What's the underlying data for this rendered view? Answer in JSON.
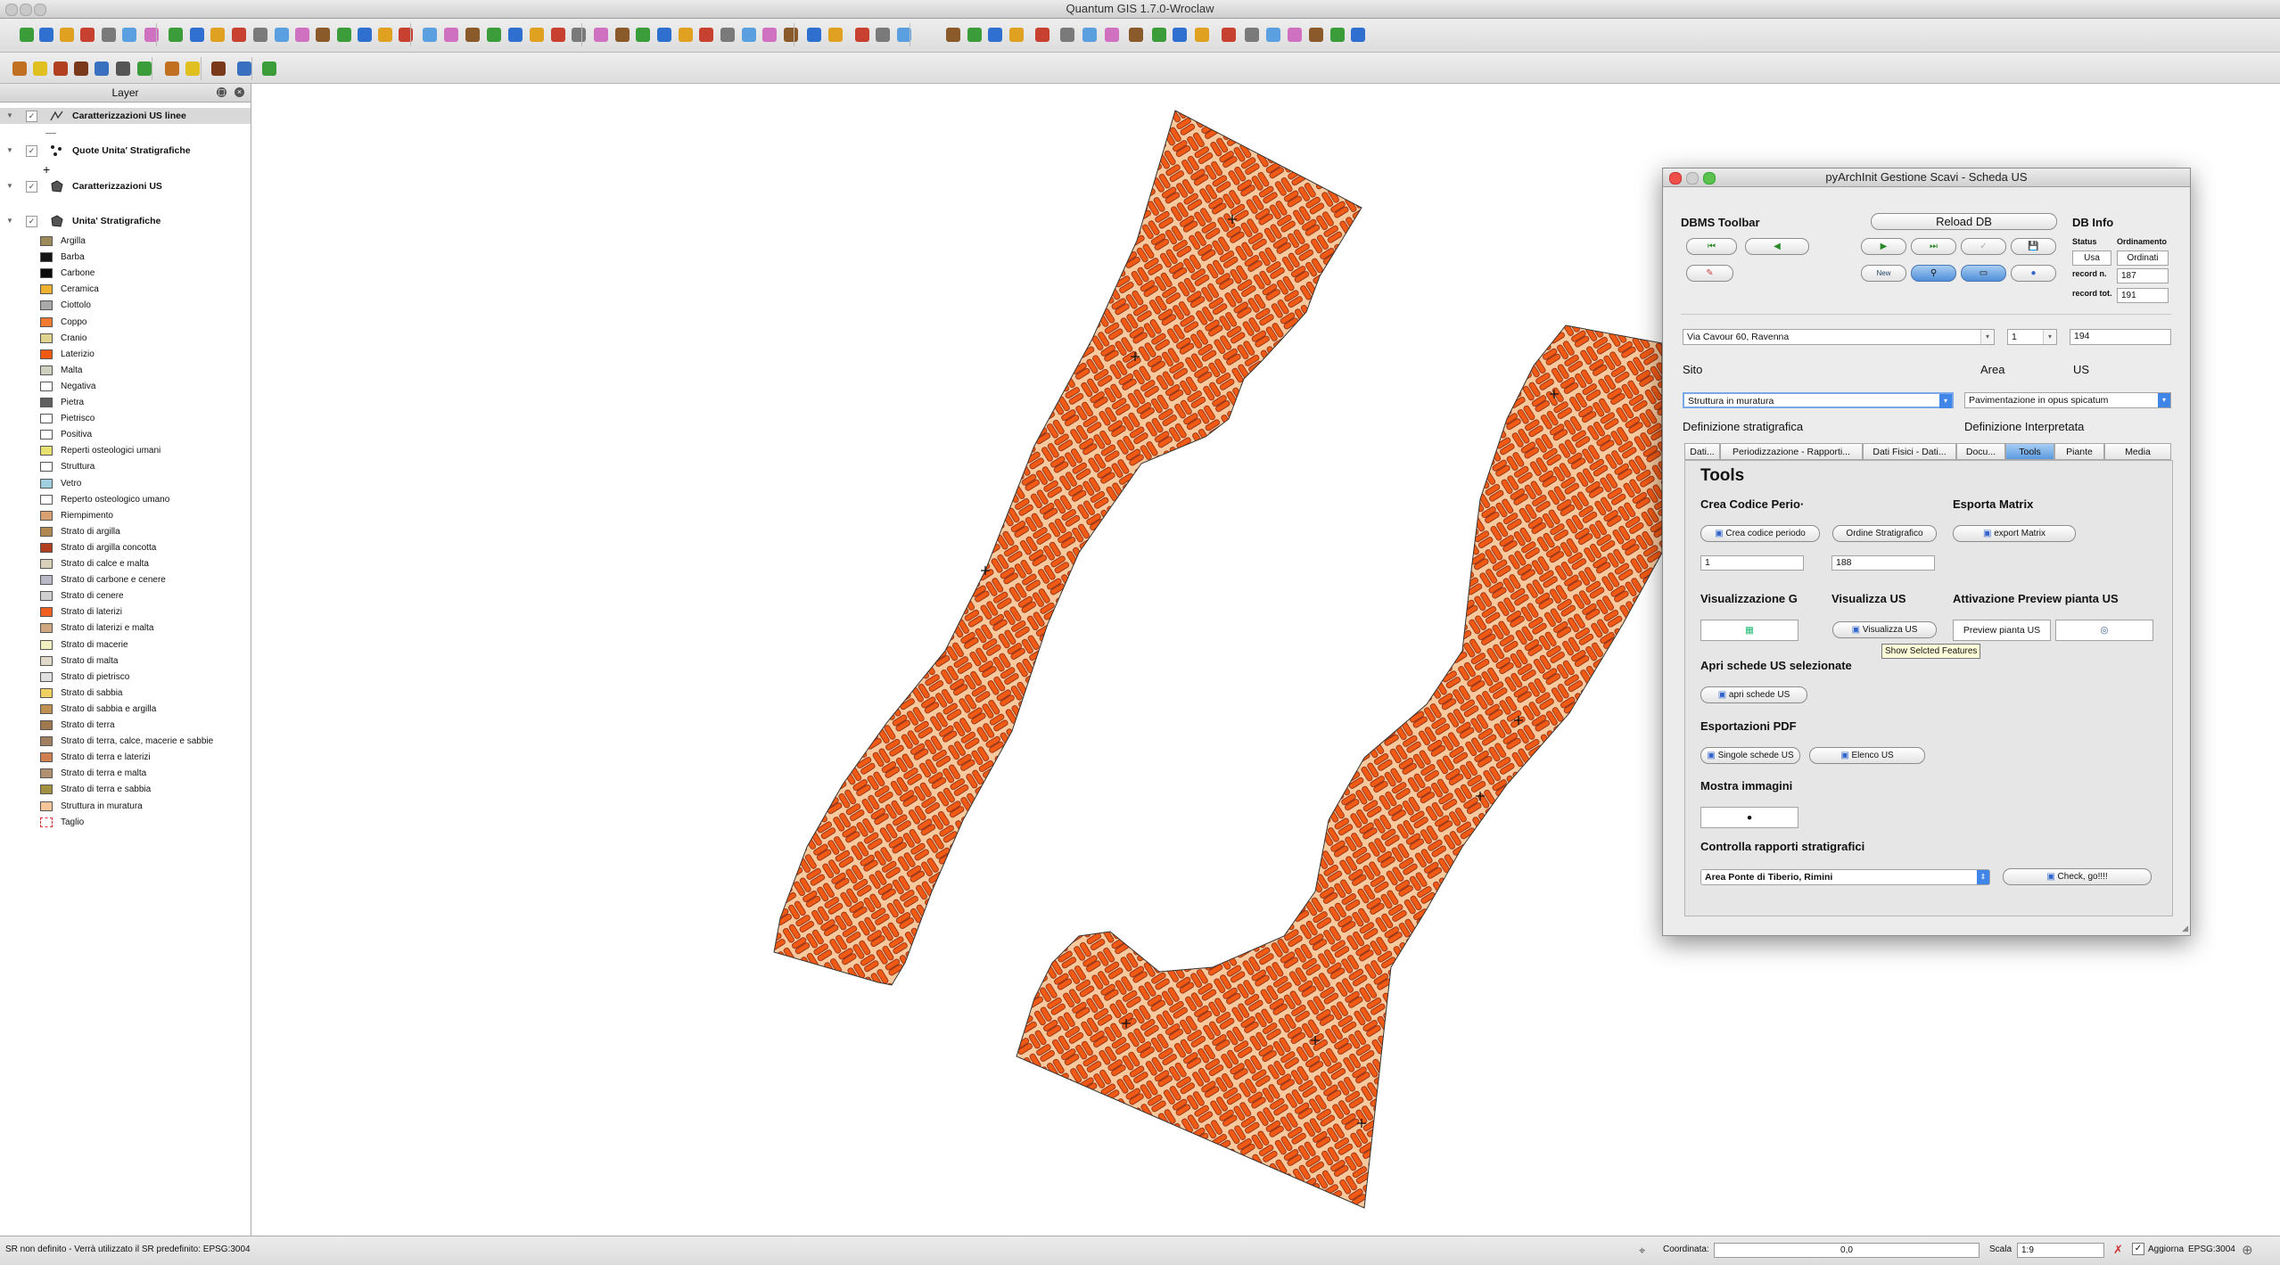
{
  "window": {
    "title": "Quantum GIS 1.7.0-Wroclaw"
  },
  "layers_panel": {
    "title": "Layer",
    "layers": [
      {
        "name": "Caratterizzazioni US linee",
        "checked": true
      },
      {
        "name": "Quote Unita' Stratigrafiche",
        "checked": true
      },
      {
        "name": "Caratterizzazioni US",
        "checked": true
      },
      {
        "name": "Unita' Stratigrafiche",
        "checked": true
      }
    ],
    "legend": [
      {
        "label": "Argilla",
        "color": "#9c8a5a"
      },
      {
        "label": "Barba",
        "color": "#141414"
      },
      {
        "label": "Carbone",
        "color": "#0a0a0a"
      },
      {
        "label": "Ceramica",
        "color": "#f0b030"
      },
      {
        "label": "Ciottolo",
        "color": "#a9a9a9"
      },
      {
        "label": "Coppo",
        "color": "#f07a30"
      },
      {
        "label": "Cranio",
        "color": "#e0d490"
      },
      {
        "label": "Laterizio",
        "color": "#f05a10"
      },
      {
        "label": "Malta",
        "color": "#d0d0c0"
      },
      {
        "label": "Negativa",
        "color": "#ffffff"
      },
      {
        "label": "Pietra",
        "color": "#606060"
      },
      {
        "label": "Pietrisco",
        "color": "#ffffff"
      },
      {
        "label": "Positiva",
        "color": "#ffffff"
      },
      {
        "label": "Reperti osteologici umani",
        "color": "#e8e070"
      },
      {
        "label": "Struttura",
        "color": "#ffffff"
      },
      {
        "label": "Vetro",
        "color": "#a0d0e0"
      },
      {
        "label": "Reperto osteologico umano",
        "color": "#ffffff"
      },
      {
        "label": "Riempimento",
        "color": "#d8a070"
      },
      {
        "label": "Strato di argilla",
        "color": "#b08850"
      },
      {
        "label": "Strato di argilla concotta",
        "color": "#b04020"
      },
      {
        "label": "Strato di calce e malta",
        "color": "#d8d0b8"
      },
      {
        "label": "Strato di carbone e cenere",
        "color": "#b8b8c8"
      },
      {
        "label": "Strato di cenere",
        "color": "#d0d0d0"
      },
      {
        "label": "Strato di laterizi",
        "color": "#f06020"
      },
      {
        "label": "Strato di laterizi e malta",
        "color": "#d0a880"
      },
      {
        "label": "Strato di macerie",
        "color": "#f0f0c0"
      },
      {
        "label": "Strato di malta",
        "color": "#e0d8c8"
      },
      {
        "label": "Strato di pietrisco",
        "color": "#e0e0e0"
      },
      {
        "label": "Strato di sabbia",
        "color": "#f0d060"
      },
      {
        "label": "Strato di sabbia e argilla",
        "color": "#c09050"
      },
      {
        "label": "Strato di terra",
        "color": "#a07850"
      },
      {
        "label": "Strato di terra, calce, macerie e sabbie",
        "color": "#a08060"
      },
      {
        "label": "Strato di terra e laterizi",
        "color": "#d08050"
      },
      {
        "label": "Strato di terra e malta",
        "color": "#b09070"
      },
      {
        "label": "Strato di terra e sabbia",
        "color": "#a09040"
      },
      {
        "label": "Struttura in muratura",
        "color": "#f7c79a"
      },
      {
        "label": "Taglio",
        "color": "#ffffff"
      }
    ]
  },
  "colors": {
    "brick": "#f05a14",
    "brick_edge": "#7a1a08",
    "mortar": "#f8c99c",
    "accent_blue": "#3f86e8"
  },
  "statusbar": {
    "message": "SR non definito - Verrà utilizzato il SR predefinito: EPSG:3004",
    "coord_label": "Coordinata:",
    "coord_value": "0,0",
    "scale_label": "Scala",
    "scale_value": "1:9",
    "render_label": "Aggiorna",
    "epsg": "EPSG:3004"
  },
  "dialog": {
    "title": "pyArchInit Gestione Scavi - Scheda US",
    "dbms_toolbar": "DBMS Toolbar",
    "reload_db": "Reload DB",
    "new_label": "New",
    "db_info": "DB Info",
    "status_label": "Status",
    "status_value": "Usa",
    "ordering_label": "Ordinamento",
    "ordering_value": "Ordinati",
    "record_n_label": "record n.",
    "record_n_value": "187",
    "record_tot_label": "record tot.",
    "record_tot_value": "191",
    "sito_value": "Via Cavour 60, Ravenna",
    "area_value": "1",
    "us_value": "194",
    "sito_label": "Sito",
    "area_label": "Area",
    "us_label": "US",
    "def_strat_value": "Struttura in muratura",
    "def_interp_value": "Pavimentazione in opus spicatum",
    "def_strat_label": "Definizione stratigrafica",
    "def_interp_label": "Definizione Interpretata",
    "tabs": [
      "Dati...",
      "Periodizzazione - Rapporti...",
      "Dati Fisici - Dati...",
      "Docu...",
      "Tools",
      "Piante",
      "Media"
    ],
    "active_tab": "Tools",
    "tools": {
      "heading": "Tools",
      "crea_codice_label": "Crea Codice Perio·",
      "esporta_matrix_label": "Esporta Matrix",
      "crea_codice_btn": "Crea codice periodo",
      "ordine_btn": "Ordine Stratigrafico",
      "export_matrix_btn": "export Matrix",
      "field1": "1",
      "field2": "188",
      "vis_g_label": "Visualizzazione G",
      "vis_us_label": "Visualizza US",
      "preview_label": "Attivazione Preview pianta US",
      "vis_us_btn": "Visualizza US",
      "preview_btn": "Preview pianta US",
      "tooltip": "Show Selcted Features",
      "apri_label": "Apri schede US selezionate",
      "apri_btn": "apri schede US",
      "pdf_label": "Esportazioni PDF",
      "singole_btn": "Singole schede US",
      "elenco_btn": "Elenco US",
      "immagini_label": "Mostra immagini",
      "controlla_label": "Controlla rapporti stratigrafici",
      "controlla_combo": "Area Ponte di Tiberio, Rimini",
      "check_btn": "Check, go!!!!"
    }
  }
}
